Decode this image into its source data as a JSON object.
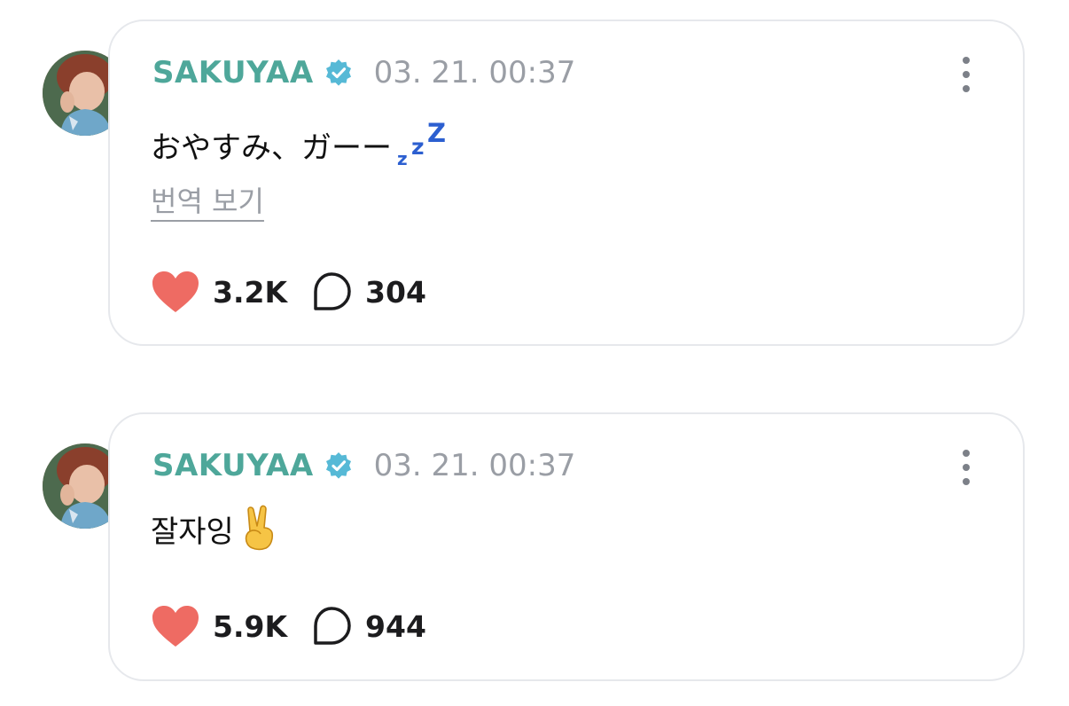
{
  "posts": [
    {
      "author": "SAKUYAA",
      "timestamp": "03. 21. 00:37",
      "text": "おやすみ、ガーー",
      "translate_label": "번역 보기",
      "likes": "3.2K",
      "comments": "304",
      "emoji": "zzz"
    },
    {
      "author": "SAKUYAA",
      "timestamp": "03. 21. 00:37",
      "text": "잘자잉",
      "likes": "5.9K",
      "comments": "944",
      "emoji": "victory-hand"
    }
  ],
  "colors": {
    "name": "#4ea79a",
    "verified": "#56b9d6",
    "heart": "#ee6b63",
    "muted": "#9a9ea5",
    "card_border": "#e6e8ec"
  }
}
